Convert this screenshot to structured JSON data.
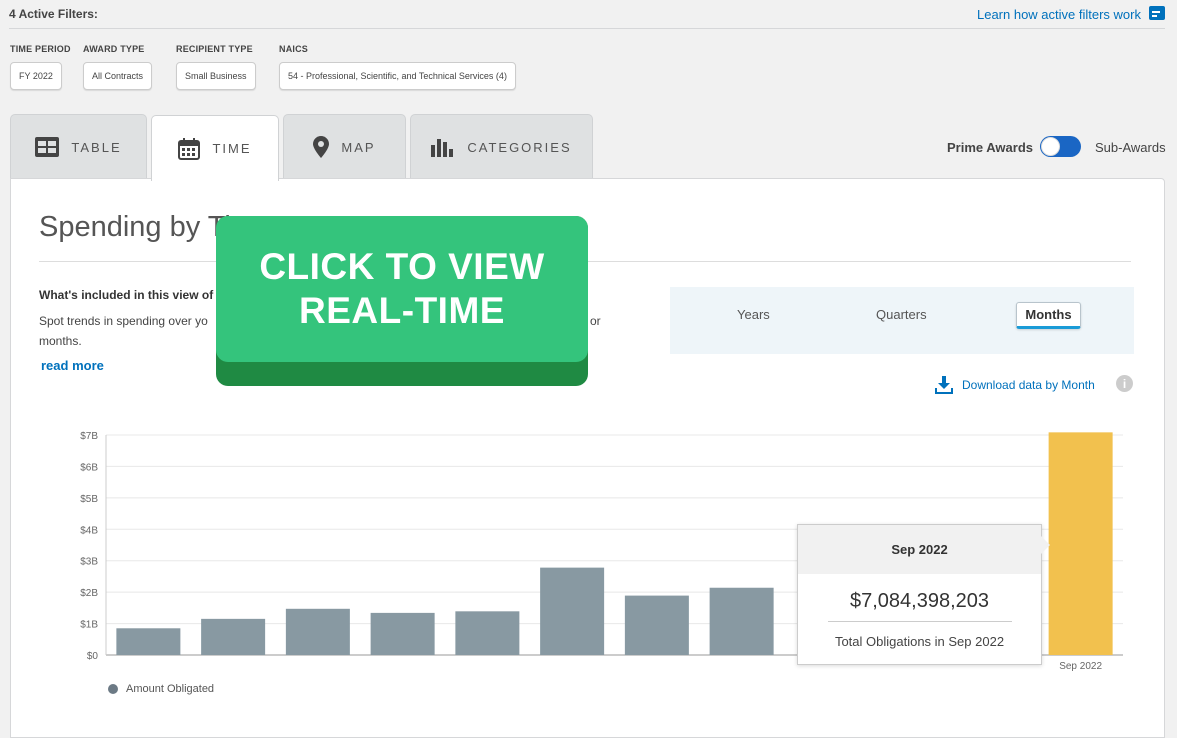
{
  "filters": {
    "title": "4 Active Filters:",
    "learn_link": "Learn how active filters work",
    "groups": [
      {
        "label": "TIME PERIOD",
        "value": "FY 2022"
      },
      {
        "label": "AWARD TYPE",
        "value": "All Contracts"
      },
      {
        "label": "RECIPIENT TYPE",
        "value": "Small Business"
      },
      {
        "label": "NAICS",
        "value": "54 - Professional, Scientific, and Technical Services (4)"
      }
    ]
  },
  "tabs": [
    {
      "label": "TABLE",
      "icon": "table-icon",
      "active": false
    },
    {
      "label": "TIME",
      "icon": "calendar-icon",
      "active": true
    },
    {
      "label": "MAP",
      "icon": "map-pin-icon",
      "active": false
    },
    {
      "label": "CATEGORIES",
      "icon": "bar-chart-icon",
      "active": false
    }
  ],
  "toggle": {
    "prime": "Prime Awards",
    "sub": "Sub-Awards",
    "state": "prime"
  },
  "section": {
    "title": "Spending by Ti",
    "included_title": "What's included in this view of",
    "desc_line1": "Spot trends in spending over yo",
    "desc_or": "or",
    "desc_line2": "months.",
    "read_more": "read more"
  },
  "periods": {
    "years": "Years",
    "quarters": "Quarters",
    "months": "Months",
    "selected": "Months"
  },
  "download": {
    "label": "Download data by Month",
    "info": "i"
  },
  "chart_data": {
    "type": "bar",
    "y_ticks": [
      "$7B",
      "$6B",
      "$5B",
      "$4B",
      "$3B",
      "$2B",
      "$1B",
      "$0"
    ],
    "ylim": [
      0,
      7000000000
    ],
    "categories": [
      "",
      "",
      "",
      "",
      "",
      "",
      "",
      "",
      "",
      "",
      "",
      "Sep 2022"
    ],
    "x_tick_labels": [
      "",
      "",
      "",
      "",
      "",
      "",
      "",
      "",
      "",
      "",
      "",
      "Sep 2022"
    ],
    "series": [
      {
        "name": "Amount Obligated",
        "color": "#8899a2",
        "highlight_color": "#f2c14e",
        "values": [
          850000000,
          1150000000,
          1470000000,
          1340000000,
          1390000000,
          2780000000,
          1890000000,
          2140000000,
          null,
          null,
          null,
          7084398203
        ]
      }
    ],
    "grid": true,
    "legend": "bottom-left"
  },
  "tooltip": {
    "title": "Sep 2022",
    "value": "$7,084,398,203",
    "caption": "Total Obligations in Sep 2022"
  },
  "overlay": {
    "line1": "CLICK TO VIEW",
    "line2": "REAL-TIME"
  }
}
